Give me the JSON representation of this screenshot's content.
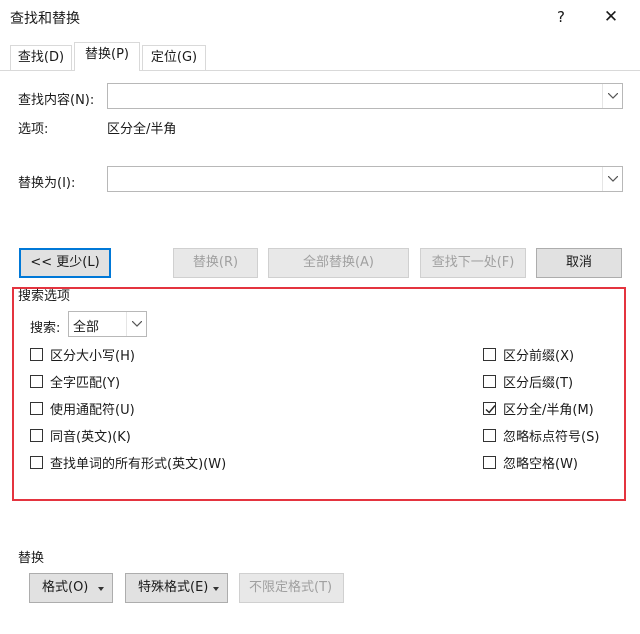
{
  "window": {
    "title": "查找和替换",
    "help_symbol": "?",
    "close_symbol": "✕"
  },
  "tabs": [
    {
      "label": "查找(D)",
      "active": false
    },
    {
      "label": "替换(P)",
      "active": true
    },
    {
      "label": "定位(G)",
      "active": false
    }
  ],
  "find": {
    "label": "查找内容(N):",
    "value": ""
  },
  "options": {
    "label": "选项:",
    "value": "区分全/半角"
  },
  "replace": {
    "label": "替换为(I):",
    "value": ""
  },
  "buttons": {
    "less": "<< 更少(L)",
    "replace": "替换(R)",
    "replace_all": "全部替换(A)",
    "find_next": "查找下一处(F)",
    "cancel": "取消"
  },
  "search_options": {
    "heading": "搜索选项",
    "search_label": "搜索:",
    "search_value": "全部",
    "left": [
      {
        "label": "区分大小写(H)",
        "checked": false
      },
      {
        "label": "全字匹配(Y)",
        "checked": false
      },
      {
        "label": "使用通配符(U)",
        "checked": false
      },
      {
        "label": "同音(英文)(K)",
        "checked": false
      },
      {
        "label": "查找单词的所有形式(英文)(W)",
        "checked": false
      }
    ],
    "right": [
      {
        "label": "区分前缀(X)",
        "checked": false
      },
      {
        "label": "区分后缀(T)",
        "checked": false
      },
      {
        "label": "区分全/半角(M)",
        "checked": true
      },
      {
        "label": "忽略标点符号(S)",
        "checked": false
      },
      {
        "label": "忽略空格(W)",
        "checked": false
      }
    ]
  },
  "replace_section": {
    "heading": "替换",
    "format": "格式(O)",
    "special": "特殊格式(E)",
    "no_format": "不限定格式(T)"
  },
  "colors": {
    "highlight_border": "#e4343f",
    "focus_border": "#0078d7"
  }
}
